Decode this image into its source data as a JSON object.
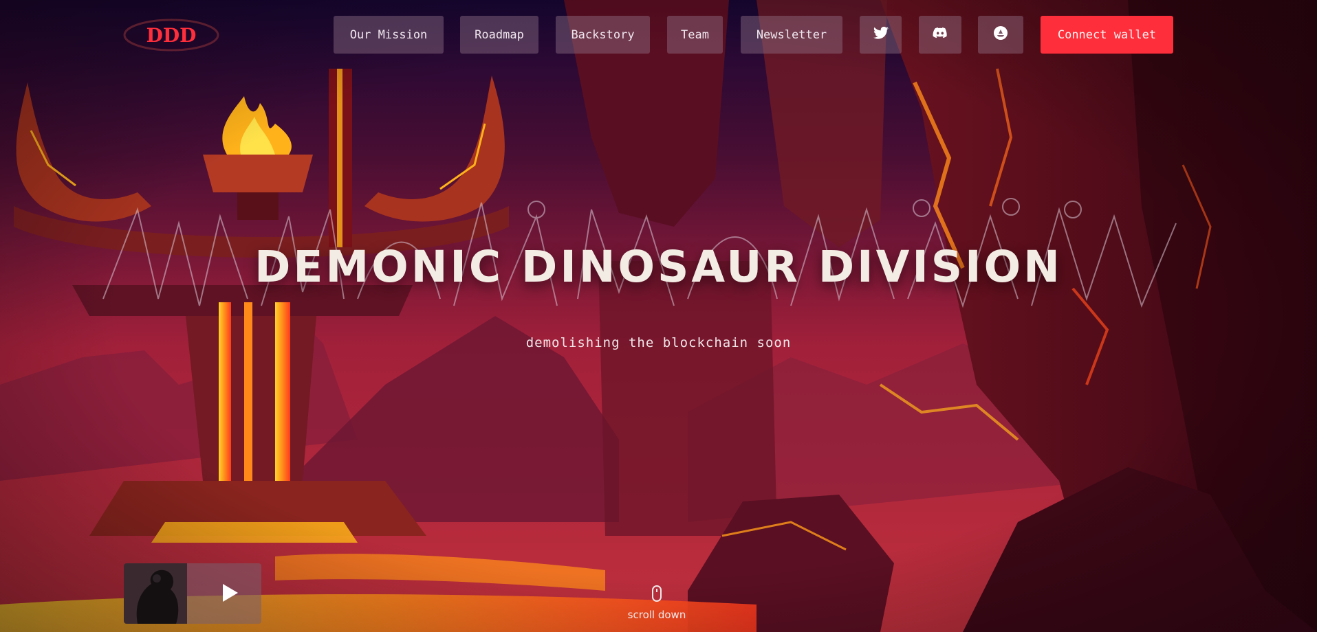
{
  "brand": {
    "logo_text": "DDD"
  },
  "nav": {
    "items": [
      "Our Mission",
      "Roadmap",
      "Backstory",
      "Team",
      "Newsletter"
    ],
    "social_icons": [
      "twitter-icon",
      "discord-icon",
      "opensea-icon"
    ],
    "connect_wallet": "Connect wallet"
  },
  "hero": {
    "title": "DEMONIC DINOSAUR DIVISION",
    "subtitle": "demolishing the blockchain soon"
  },
  "player": {
    "icon": "play-icon"
  },
  "scroll": {
    "label": "scroll down",
    "icon": "mouse-icon"
  },
  "colors": {
    "accent": "#ff2e3b",
    "lava": "#ffb21a",
    "background": "#2a0718"
  }
}
